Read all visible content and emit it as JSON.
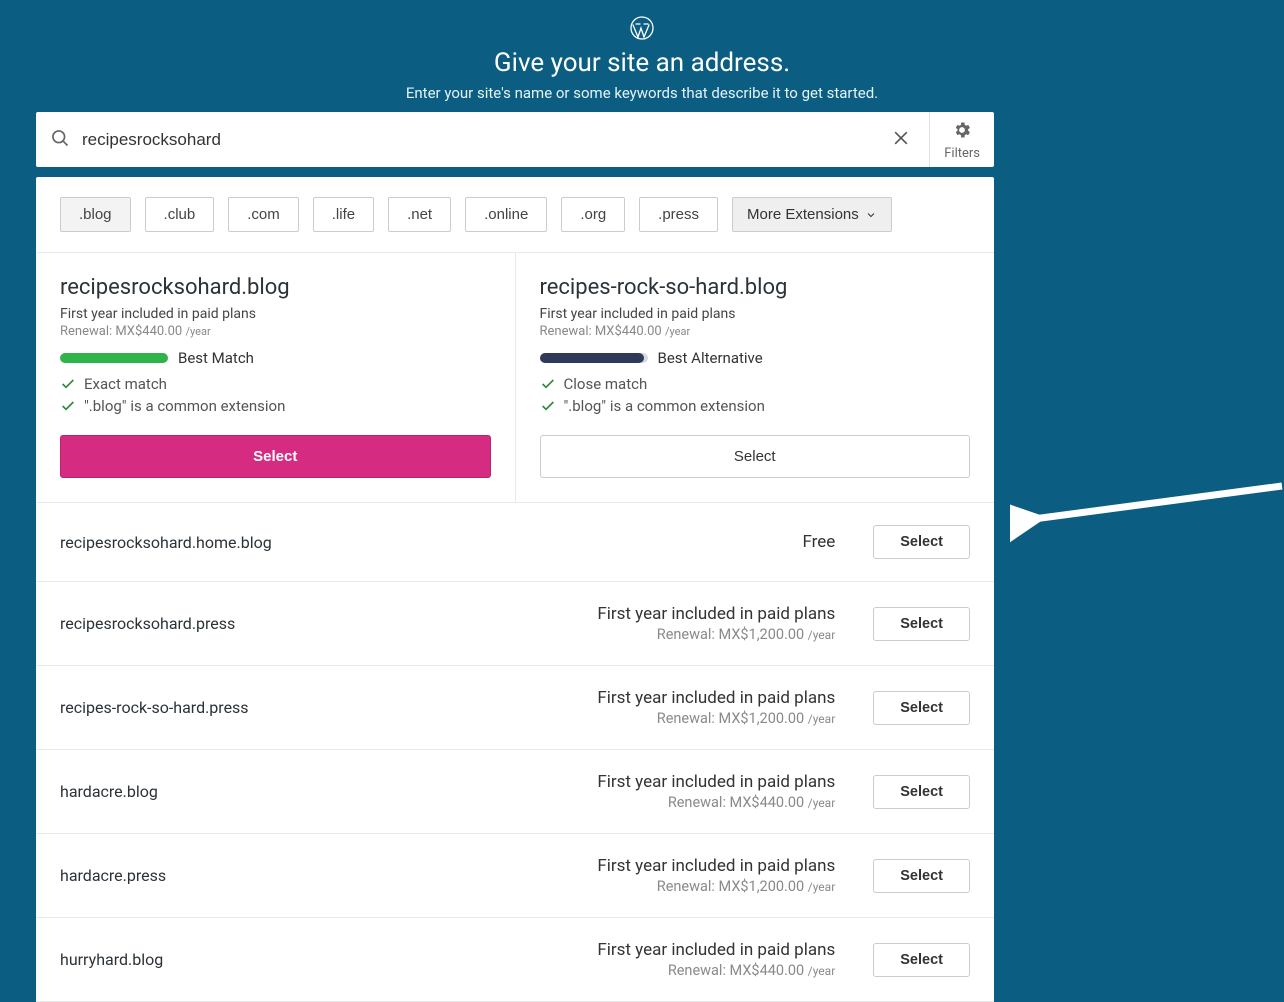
{
  "header": {
    "title": "Give your site an address.",
    "subtitle": "Enter your site's name or some keywords that describe it to get started."
  },
  "search": {
    "value": "recipesrocksohard",
    "filters_label": "Filters"
  },
  "extensions": [
    ".blog",
    ".club",
    ".com",
    ".life",
    ".net",
    ".online",
    ".org",
    ".press"
  ],
  "more_ext_label": "More Extensions",
  "featured": [
    {
      "domain": "recipesrocksohard.blog",
      "plan_note": "First year included in paid plans",
      "renewal": "Renewal: MX$440.00",
      "per": "/year",
      "match_label": "Best Match",
      "checks": [
        "Exact match",
        "\".blog\" is a common extension"
      ],
      "select": "Select"
    },
    {
      "domain": "recipes-rock-so-hard.blog",
      "plan_note": "First year included in paid plans",
      "renewal": "Renewal: MX$440.00",
      "per": "/year",
      "match_label": "Best Alternative",
      "checks": [
        "Close match",
        "\".blog\" is a common extension"
      ],
      "select": "Select"
    }
  ],
  "rows": [
    {
      "domain": "recipesrocksohard.home.blog",
      "free": "Free",
      "select": "Select"
    },
    {
      "domain": "recipesrocksohard.press",
      "line1": "First year included in paid plans",
      "line2": "Renewal: MX$1,200.00",
      "per": "/year",
      "select": "Select"
    },
    {
      "domain": "recipes-rock-so-hard.press",
      "line1": "First year included in paid plans",
      "line2": "Renewal: MX$1,200.00",
      "per": "/year",
      "select": "Select"
    },
    {
      "domain": "hardacre.blog",
      "line1": "First year included in paid plans",
      "line2": "Renewal: MX$440.00",
      "per": "/year",
      "select": "Select"
    },
    {
      "domain": "hardacre.press",
      "line1": "First year included in paid plans",
      "line2": "Renewal: MX$1,200.00",
      "per": "/year",
      "select": "Select"
    },
    {
      "domain": "hurryhard.blog",
      "line1": "First year included in paid plans",
      "line2": "Renewal: MX$440.00",
      "per": "/year",
      "select": "Select"
    }
  ]
}
